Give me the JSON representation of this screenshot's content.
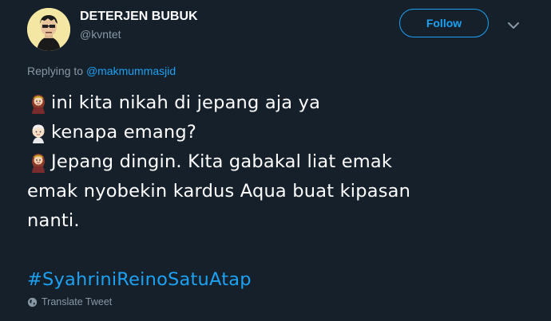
{
  "user": {
    "display_name": "DETERJEN BUBUK",
    "handle": "@kvntet",
    "follow_label": "Follow"
  },
  "reply": {
    "prefix": "Replying to ",
    "mention": "@makmummasjid"
  },
  "tweet": {
    "lines": [
      "ini kita nikah di jepang aja ya",
      "kenapa emang?",
      "Jepang dingin. Kita gabakal liat emak",
      "emak nyobekin kardus Aqua buat kipasan",
      "nanti."
    ],
    "hashtag": "#SyahriniReinoSatuAtap"
  },
  "footer": {
    "translate_label": "Translate Tweet"
  },
  "icons": {
    "avatar": "cartoon-avatar",
    "chevron": "chevron-down-icon",
    "emoji_woman": "woman-emoji-icon",
    "emoji_face": "face-emoji-icon",
    "globe": "globe-icon"
  },
  "colors": {
    "background": "#15202b",
    "accent": "#1da1f2",
    "secondary_text": "#8899a6"
  }
}
